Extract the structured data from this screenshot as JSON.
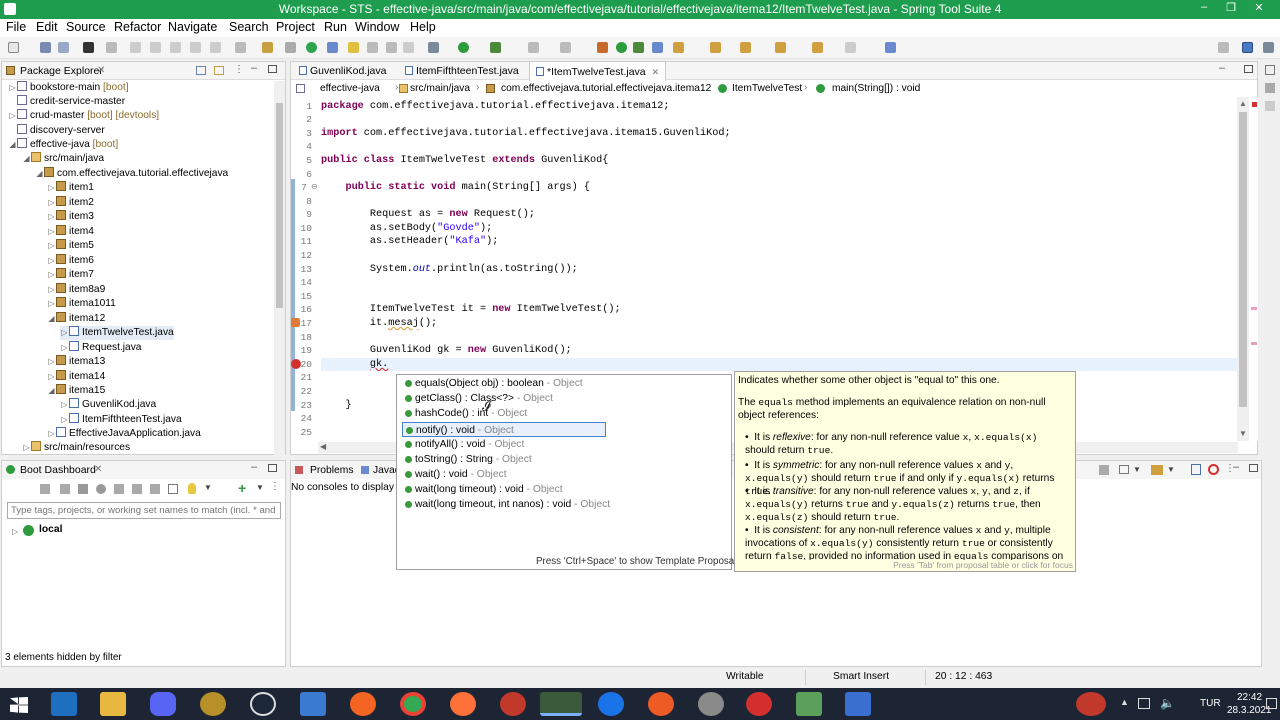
{
  "window": {
    "title": "Workspace - STS - effective-java/src/main/java/com/effectivejava/tutorial/effectivejava/itema12/ItemTwelveTest.java - Spring Tool Suite 4"
  },
  "menu": [
    "File",
    "Edit",
    "Source",
    "Refactor",
    "Navigate",
    "Search",
    "Project",
    "Run",
    "Window",
    "Help"
  ],
  "package_explorer": {
    "title": "Package Explorer",
    "items": [
      {
        "label": "bookstore-main",
        "deco": " [boot]"
      },
      {
        "label": "credit-service-master",
        "deco": ""
      },
      {
        "label": "crud-master",
        "deco": " [boot] [devtools]"
      },
      {
        "label": "discovery-server",
        "deco": ""
      },
      {
        "label": "effective-java",
        "deco": " [boot]"
      },
      {
        "label": "src/main/java",
        "deco": ""
      },
      {
        "label": "com.effectivejava.tutorial.effectivejava",
        "deco": ""
      },
      {
        "label": "item1",
        "deco": ""
      },
      {
        "label": "item2",
        "deco": ""
      },
      {
        "label": "item3",
        "deco": ""
      },
      {
        "label": "item4",
        "deco": ""
      },
      {
        "label": "item5",
        "deco": ""
      },
      {
        "label": "item6",
        "deco": ""
      },
      {
        "label": "item7",
        "deco": ""
      },
      {
        "label": "item8a9",
        "deco": ""
      },
      {
        "label": "itema1011",
        "deco": ""
      },
      {
        "label": "itema12",
        "deco": ""
      },
      {
        "label": "ItemTwelveTest.java",
        "deco": ""
      },
      {
        "label": "Request.java",
        "deco": ""
      },
      {
        "label": "itema13",
        "deco": ""
      },
      {
        "label": "itema14",
        "deco": ""
      },
      {
        "label": "itema15",
        "deco": ""
      },
      {
        "label": "GuvenliKod.java",
        "deco": ""
      },
      {
        "label": "ItemFifthteenTest.java",
        "deco": ""
      },
      {
        "label": "EffectiveJavaApplication.java",
        "deco": ""
      },
      {
        "label": "src/main/resources",
        "deco": ""
      }
    ]
  },
  "boot_dashboard": {
    "title": "Boot Dashboard",
    "filter_placeholder": "Type tags, projects, or working set names to match (incl. * and ?)",
    "item": "local",
    "status": "3 elements hidden by filter"
  },
  "editor": {
    "tabs": [
      "GuvenliKod.java",
      "ItemFifthteenTest.java",
      "*ItemTwelveTest.java"
    ],
    "breadcrumb": [
      "effective-java",
      "src/main/java",
      "com.effectivejava.tutorial.effectivejava.itema12",
      "ItemTwelveTest",
      "main(String[]) : void"
    ],
    "lines": [
      "1",
      "2",
      "3",
      "4",
      "5",
      "6",
      "7",
      "8",
      "9",
      "10",
      "11",
      "12",
      "13",
      "14",
      "15",
      "16",
      "17",
      "18",
      "19",
      "20",
      "21",
      "22",
      "23",
      "24",
      "25"
    ]
  },
  "autocomplete": {
    "proposals": [
      {
        "sig": "equals(Object obj) : boolean",
        "owner": " - Object"
      },
      {
        "sig": "getClass() : Class<?>",
        "owner": " - Object"
      },
      {
        "sig": "hashCode() : int",
        "owner": " - Object"
      },
      {
        "sig": "notify() : void",
        "owner": " - Object"
      },
      {
        "sig": "notifyAll() : void",
        "owner": " - Object"
      },
      {
        "sig": "toString() : String",
        "owner": " - Object"
      },
      {
        "sig": "wait() : void",
        "owner": " - Object"
      },
      {
        "sig": "wait(long timeout) : void",
        "owner": " - Object"
      },
      {
        "sig": "wait(long timeout, int nanos) : void",
        "owner": " - Object"
      }
    ],
    "footer": "Press 'Ctrl+Space' to show Template Proposals",
    "doc_intro": "Indicates whether some other object is \"equal to\" this one.",
    "doc_footer": "Press 'Tab' from proposal table or click for focus"
  },
  "bottom_tabs": {
    "problems": "Problems",
    "javadoc": "Javad",
    "console_msg": "No consoles to display a"
  },
  "statusbar": {
    "writable": "Writable",
    "insert": "Smart Insert",
    "position": "20 : 12 : 463"
  },
  "taskbar": {
    "lang": "TUR",
    "time": "22:42",
    "date": "28.3.2021"
  },
  "colors": {
    "titlebar": "#1f9d4e",
    "taskbar": "#1d2433",
    "keyword": "#7f0055",
    "string": "#2a00ff"
  }
}
